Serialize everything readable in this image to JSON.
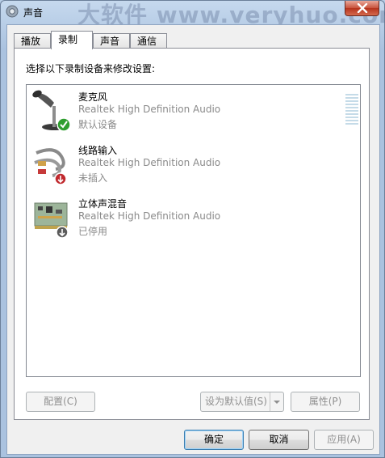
{
  "window": {
    "title": "声音",
    "watermark": "大软件 www.veryhuo.com"
  },
  "tabs": [
    {
      "label": "播放",
      "active": false
    },
    {
      "label": "录制",
      "active": true
    },
    {
      "label": "声音",
      "active": false
    },
    {
      "label": "通信",
      "active": false
    }
  ],
  "panel": {
    "instruction": "选择以下录制设备来修改设置:"
  },
  "devices": [
    {
      "name": "麦克风",
      "driver": "Realtek High Definition Audio",
      "status": "默认设备",
      "icon": "microphone-icon",
      "badge": "default-check"
    },
    {
      "name": "线路输入",
      "driver": "Realtek High Definition Audio",
      "status": "未插入",
      "icon": "line-in-cable-icon",
      "badge": "unplugged-red"
    },
    {
      "name": "立体声混音",
      "driver": "Realtek High Definition Audio",
      "status": "已停用",
      "icon": "sound-card-icon",
      "badge": "disabled-gray"
    }
  ],
  "buttons": {
    "configure": "配置(C)",
    "set_default": "设为默认值(S)",
    "properties": "属性(P)",
    "ok": "确定",
    "cancel": "取消",
    "apply": "应用(A)"
  },
  "colors": {
    "accent": "#3c7fb1",
    "check": "#2f9e2f",
    "unplugged": "#c0282d"
  }
}
